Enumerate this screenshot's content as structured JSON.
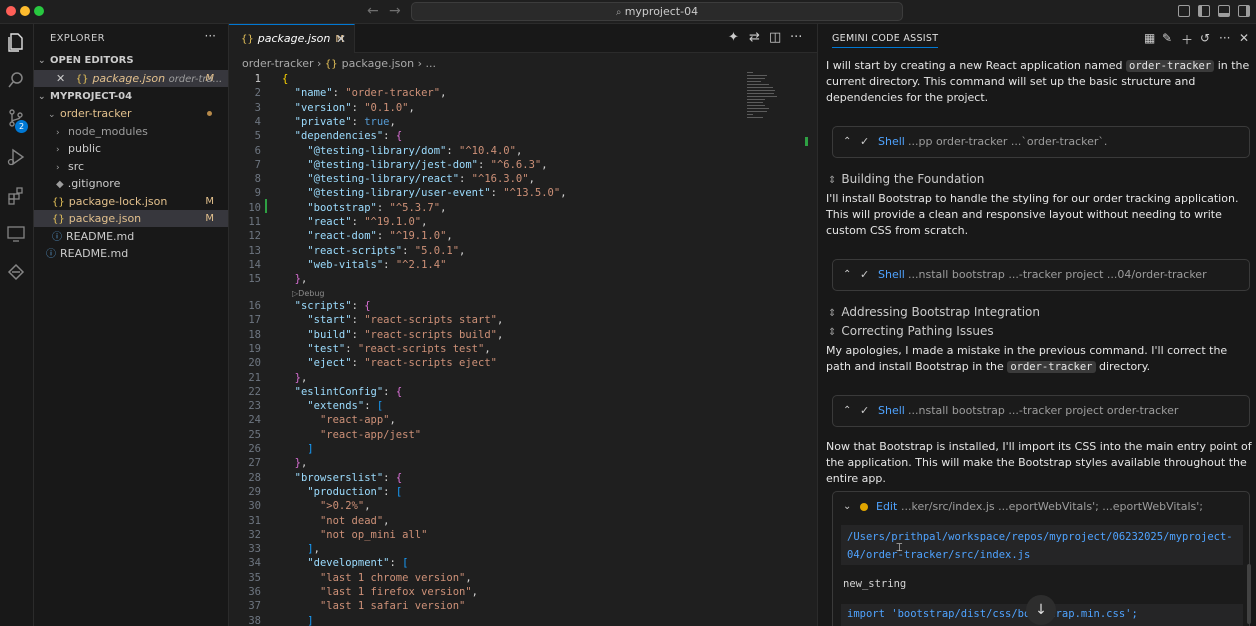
{
  "titlebar": {
    "title": "myproject-04",
    "back": "←",
    "forward": "→"
  },
  "activity": {
    "scm_badge": "2"
  },
  "explorer": {
    "title": "EXPLORER",
    "more": "···",
    "open_editors_label": "OPEN EDITORS",
    "open_editor": {
      "name": "package.json",
      "path": "order-tra...",
      "status": "M"
    },
    "project_label": "MYPROJECT-04",
    "folder": "order-tracker",
    "items": [
      {
        "name": "node_modules",
        "type": "folder"
      },
      {
        "name": "public",
        "type": "folder"
      },
      {
        "name": "src",
        "type": "folder"
      },
      {
        "name": ".gitignore",
        "type": "file"
      },
      {
        "name": "package-lock.json",
        "type": "json",
        "status": "M"
      },
      {
        "name": "package.json",
        "type": "json",
        "status": "M"
      },
      {
        "name": "README.md",
        "type": "info"
      }
    ],
    "root_readme": "README.md"
  },
  "editor": {
    "tab": {
      "name": "package.json",
      "status": "M"
    },
    "breadcrumb": {
      "folder": "order-tracker",
      "file": "package.json",
      "more": "..."
    },
    "codelens": "Debug",
    "lines": [
      [
        [
          "br1",
          "{"
        ]
      ],
      [
        [
          "p",
          "  "
        ],
        [
          "k",
          "\"name\""
        ],
        [
          "p",
          ": "
        ],
        [
          "s",
          "\"order-tracker\""
        ],
        [
          "p",
          ","
        ]
      ],
      [
        [
          "p",
          "  "
        ],
        [
          "k",
          "\"version\""
        ],
        [
          "p",
          ": "
        ],
        [
          "s",
          "\"0.1.0\""
        ],
        [
          "p",
          ","
        ]
      ],
      [
        [
          "p",
          "  "
        ],
        [
          "k",
          "\"private\""
        ],
        [
          "p",
          ": "
        ],
        [
          "b",
          "true"
        ],
        [
          "p",
          ","
        ]
      ],
      [
        [
          "p",
          "  "
        ],
        [
          "k",
          "\"dependencies\""
        ],
        [
          "p",
          ": "
        ],
        [
          "br2",
          "{"
        ]
      ],
      [
        [
          "p",
          "    "
        ],
        [
          "k",
          "\"@testing-library/dom\""
        ],
        [
          "p",
          ": "
        ],
        [
          "s",
          "\"^10.4.0\""
        ],
        [
          "p",
          ","
        ]
      ],
      [
        [
          "p",
          "    "
        ],
        [
          "k",
          "\"@testing-library/jest-dom\""
        ],
        [
          "p",
          ": "
        ],
        [
          "s",
          "\"^6.6.3\""
        ],
        [
          "p",
          ","
        ]
      ],
      [
        [
          "p",
          "    "
        ],
        [
          "k",
          "\"@testing-library/react\""
        ],
        [
          "p",
          ": "
        ],
        [
          "s",
          "\"^16.3.0\""
        ],
        [
          "p",
          ","
        ]
      ],
      [
        [
          "p",
          "    "
        ],
        [
          "k",
          "\"@testing-library/user-event\""
        ],
        [
          "p",
          ": "
        ],
        [
          "s",
          "\"^13.5.0\""
        ],
        [
          "p",
          ","
        ]
      ],
      [
        [
          "p",
          "    "
        ],
        [
          "k",
          "\"bootstrap\""
        ],
        [
          "p",
          ": "
        ],
        [
          "s",
          "\"^5.3.7\""
        ],
        [
          "p",
          ","
        ]
      ],
      [
        [
          "p",
          "    "
        ],
        [
          "k",
          "\"react\""
        ],
        [
          "p",
          ": "
        ],
        [
          "s",
          "\"^19.1.0\""
        ],
        [
          "p",
          ","
        ]
      ],
      [
        [
          "p",
          "    "
        ],
        [
          "k",
          "\"react-dom\""
        ],
        [
          "p",
          ": "
        ],
        [
          "s",
          "\"^19.1.0\""
        ],
        [
          "p",
          ","
        ]
      ],
      [
        [
          "p",
          "    "
        ],
        [
          "k",
          "\"react-scripts\""
        ],
        [
          "p",
          ": "
        ],
        [
          "s",
          "\"5.0.1\""
        ],
        [
          "p",
          ","
        ]
      ],
      [
        [
          "p",
          "    "
        ],
        [
          "k",
          "\"web-vitals\""
        ],
        [
          "p",
          ": "
        ],
        [
          "s",
          "\"^2.1.4\""
        ]
      ],
      [
        [
          "p",
          "  "
        ],
        [
          "br2",
          "}"
        ],
        [
          "p",
          ","
        ]
      ],
      [
        [
          "p",
          "  "
        ],
        [
          "k",
          "\"scripts\""
        ],
        [
          "p",
          ": "
        ],
        [
          "br2",
          "{"
        ]
      ],
      [
        [
          "p",
          "    "
        ],
        [
          "k",
          "\"start\""
        ],
        [
          "p",
          ": "
        ],
        [
          "s",
          "\"react-scripts start\""
        ],
        [
          "p",
          ","
        ]
      ],
      [
        [
          "p",
          "    "
        ],
        [
          "k",
          "\"build\""
        ],
        [
          "p",
          ": "
        ],
        [
          "s",
          "\"react-scripts build\""
        ],
        [
          "p",
          ","
        ]
      ],
      [
        [
          "p",
          "    "
        ],
        [
          "k",
          "\"test\""
        ],
        [
          "p",
          ": "
        ],
        [
          "s",
          "\"react-scripts test\""
        ],
        [
          "p",
          ","
        ]
      ],
      [
        [
          "p",
          "    "
        ],
        [
          "k",
          "\"eject\""
        ],
        [
          "p",
          ": "
        ],
        [
          "s",
          "\"react-scripts eject\""
        ]
      ],
      [
        [
          "p",
          "  "
        ],
        [
          "br2",
          "}"
        ],
        [
          "p",
          ","
        ]
      ],
      [
        [
          "p",
          "  "
        ],
        [
          "k",
          "\"eslintConfig\""
        ],
        [
          "p",
          ": "
        ],
        [
          "br2",
          "{"
        ]
      ],
      [
        [
          "p",
          "    "
        ],
        [
          "k",
          "\"extends\""
        ],
        [
          "p",
          ": "
        ],
        [
          "br3",
          "["
        ]
      ],
      [
        [
          "p",
          "      "
        ],
        [
          "s",
          "\"react-app\""
        ],
        [
          "p",
          ","
        ]
      ],
      [
        [
          "p",
          "      "
        ],
        [
          "s",
          "\"react-app/jest\""
        ]
      ],
      [
        [
          "p",
          "    "
        ],
        [
          "br3",
          "]"
        ]
      ],
      [
        [
          "p",
          "  "
        ],
        [
          "br2",
          "}"
        ],
        [
          "p",
          ","
        ]
      ],
      [
        [
          "p",
          "  "
        ],
        [
          "k",
          "\"browserslist\""
        ],
        [
          "p",
          ": "
        ],
        [
          "br2",
          "{"
        ]
      ],
      [
        [
          "p",
          "    "
        ],
        [
          "k",
          "\"production\""
        ],
        [
          "p",
          ": "
        ],
        [
          "br3",
          "["
        ]
      ],
      [
        [
          "p",
          "      "
        ],
        [
          "s",
          "\">0.2%\""
        ],
        [
          "p",
          ","
        ]
      ],
      [
        [
          "p",
          "      "
        ],
        [
          "s",
          "\"not dead\""
        ],
        [
          "p",
          ","
        ]
      ],
      [
        [
          "p",
          "      "
        ],
        [
          "s",
          "\"not op_mini all\""
        ]
      ],
      [
        [
          "p",
          "    "
        ],
        [
          "br3",
          "]"
        ],
        [
          "p",
          ","
        ]
      ],
      [
        [
          "p",
          "    "
        ],
        [
          "k",
          "\"development\""
        ],
        [
          "p",
          ": "
        ],
        [
          "br3",
          "["
        ]
      ],
      [
        [
          "p",
          "      "
        ],
        [
          "s",
          "\"last 1 chrome version\""
        ],
        [
          "p",
          ","
        ]
      ],
      [
        [
          "p",
          "      "
        ],
        [
          "s",
          "\"last 1 firefox version\""
        ],
        [
          "p",
          ","
        ]
      ],
      [
        [
          "p",
          "      "
        ],
        [
          "s",
          "\"last 1 safari version\""
        ]
      ],
      [
        [
          "p",
          "    "
        ],
        [
          "br3",
          "]"
        ]
      ]
    ]
  },
  "gemini": {
    "title": "GEMINI CODE ASSIST",
    "intro_pre": "I will start by creating a new React application named",
    "intro_code": "order-tracker",
    "intro_post": "in the current directory. This command will set up the basic structure and dependencies for the project.",
    "shell_label": "Shell",
    "shell1": "...pp order-tracker ...`order-tracker`.",
    "thought1": "Building the Foundation",
    "para2": "I'll install Bootstrap to handle the styling for our order tracking application. This will provide a clean and responsive layout without needing to write custom CSS from scratch.",
    "shell2": "...nstall bootstrap ...-tracker project ...04/order-tracker",
    "thought2": "Addressing Bootstrap Integration",
    "thought3": "Correcting Pathing Issues",
    "para3_pre": "My apologies, I made a mistake in the previous command. I'll correct the path and install Bootstrap in the",
    "para3_code": "order-tracker",
    "para3_post": "directory.",
    "shell3": "...nstall bootstrap ...-tracker project order-tracker",
    "para4": "Now that Bootstrap is installed, I'll import its CSS into the main entry point of the application. This will make the Bootstrap styles available throughout the entire app.",
    "edit_label": "Edit",
    "edit_cmd": "...ker/src/index.js ...eportWebVitals'; ...eportWebVitals';",
    "edit_path": "/Users/prithpal/workspace/repos/myproject/06232025/myproject-\n04/order-tracker/src/index.js",
    "new_string_label": "new_string",
    "import_line": "import 'bootstrap/dist/css/bootstrap.min.css';"
  }
}
